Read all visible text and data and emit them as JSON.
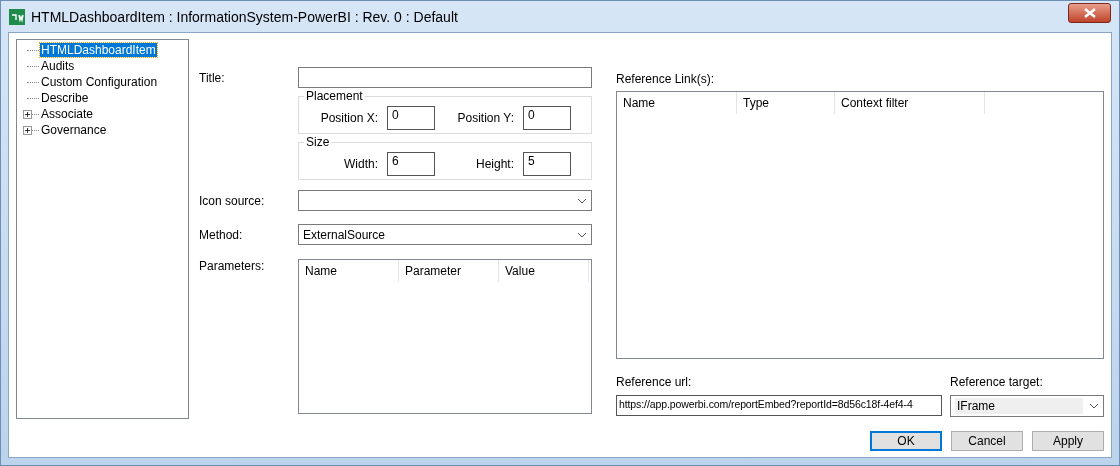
{
  "window": {
    "title": "HTMLDashboardItem : InformationSystem-PowerBI : Rev. 0  : Default"
  },
  "tree": [
    {
      "label": "HTMLDashboardItem",
      "selected": true,
      "expandable": false
    },
    {
      "label": "Audits",
      "selected": false,
      "expandable": false
    },
    {
      "label": "Custom Configuration",
      "selected": false,
      "expandable": false
    },
    {
      "label": "Describe",
      "selected": false,
      "expandable": false
    },
    {
      "label": "Associate",
      "selected": false,
      "expandable": true
    },
    {
      "label": "Governance",
      "selected": false,
      "expandable": true
    }
  ],
  "title_field": {
    "label": "Title:"
  },
  "groups": [
    {
      "legend": "Placement",
      "fields": [
        {
          "label": "Position X:",
          "value": "0"
        },
        {
          "label": "Position Y:",
          "value": "0"
        }
      ]
    },
    {
      "legend": "Size",
      "fields": [
        {
          "label": "Width:",
          "value": "6"
        },
        {
          "label": "Height:",
          "value": "5"
        }
      ]
    }
  ],
  "icon_source": {
    "label": "Icon source:"
  },
  "method": {
    "label": "Method:",
    "value": "ExternalSource"
  },
  "parameters": {
    "label": "Parameters:",
    "columns": [
      "Name",
      "Parameter",
      "Value"
    ]
  },
  "reference_links": {
    "label": "Reference Link(s):",
    "columns": [
      "Name",
      "Type",
      "Context filter"
    ]
  },
  "reference_url": {
    "label": "Reference url:",
    "value": "https://app.powerbi.com/reportEmbed?reportId=8d56c18f-4ef4-4"
  },
  "reference_target": {
    "label": "Reference target:",
    "value": "IFrame"
  },
  "buttons": [
    {
      "label": "OK",
      "default": true
    },
    {
      "label": "Cancel",
      "default": false
    },
    {
      "label": "Apply",
      "default": false
    }
  ]
}
